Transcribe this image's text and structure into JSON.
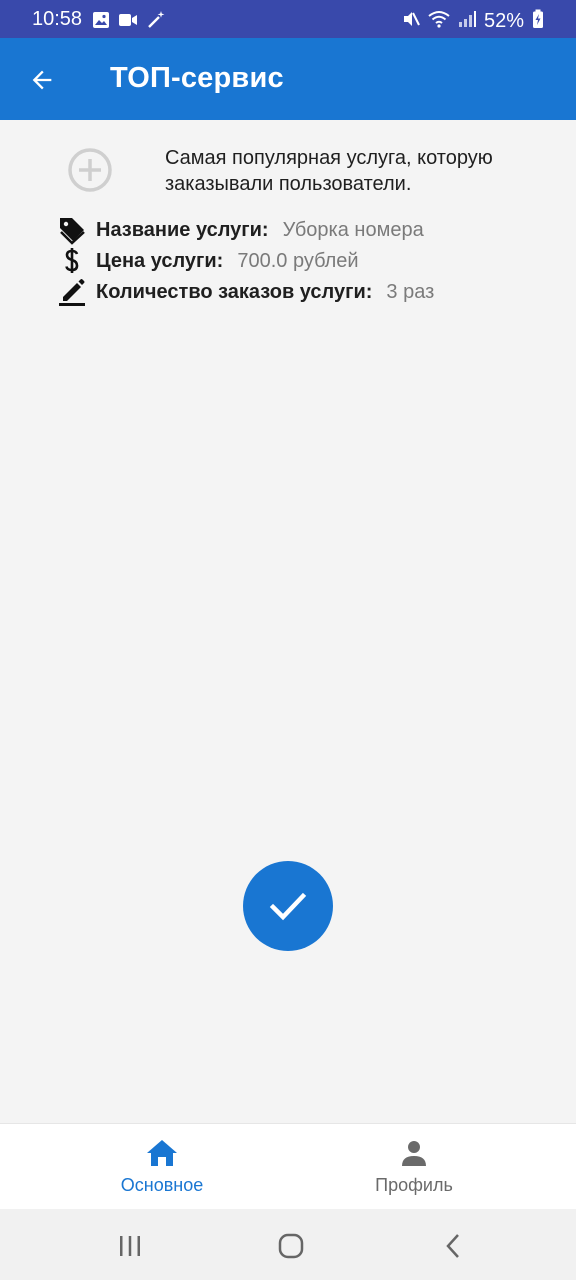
{
  "status_bar": {
    "time": "10:58",
    "battery": "52%"
  },
  "app_bar": {
    "title": "ТОП-сервис"
  },
  "intro": {
    "text": "Самая популярная услуга, которую заказывали пользователи."
  },
  "service_info": {
    "name_label": "Название услуги:",
    "name_value": "Уборка номера",
    "price_label": "Цена услуги:",
    "price_value": "700.0 рублей",
    "orders_label": "Количество заказов услуги:",
    "orders_value": "3 раз"
  },
  "bottom_nav": {
    "home_label": "Основное",
    "profile_label": "Профиль"
  },
  "colors": {
    "primary": "#1976d2",
    "status_bar": "#3949ab"
  }
}
